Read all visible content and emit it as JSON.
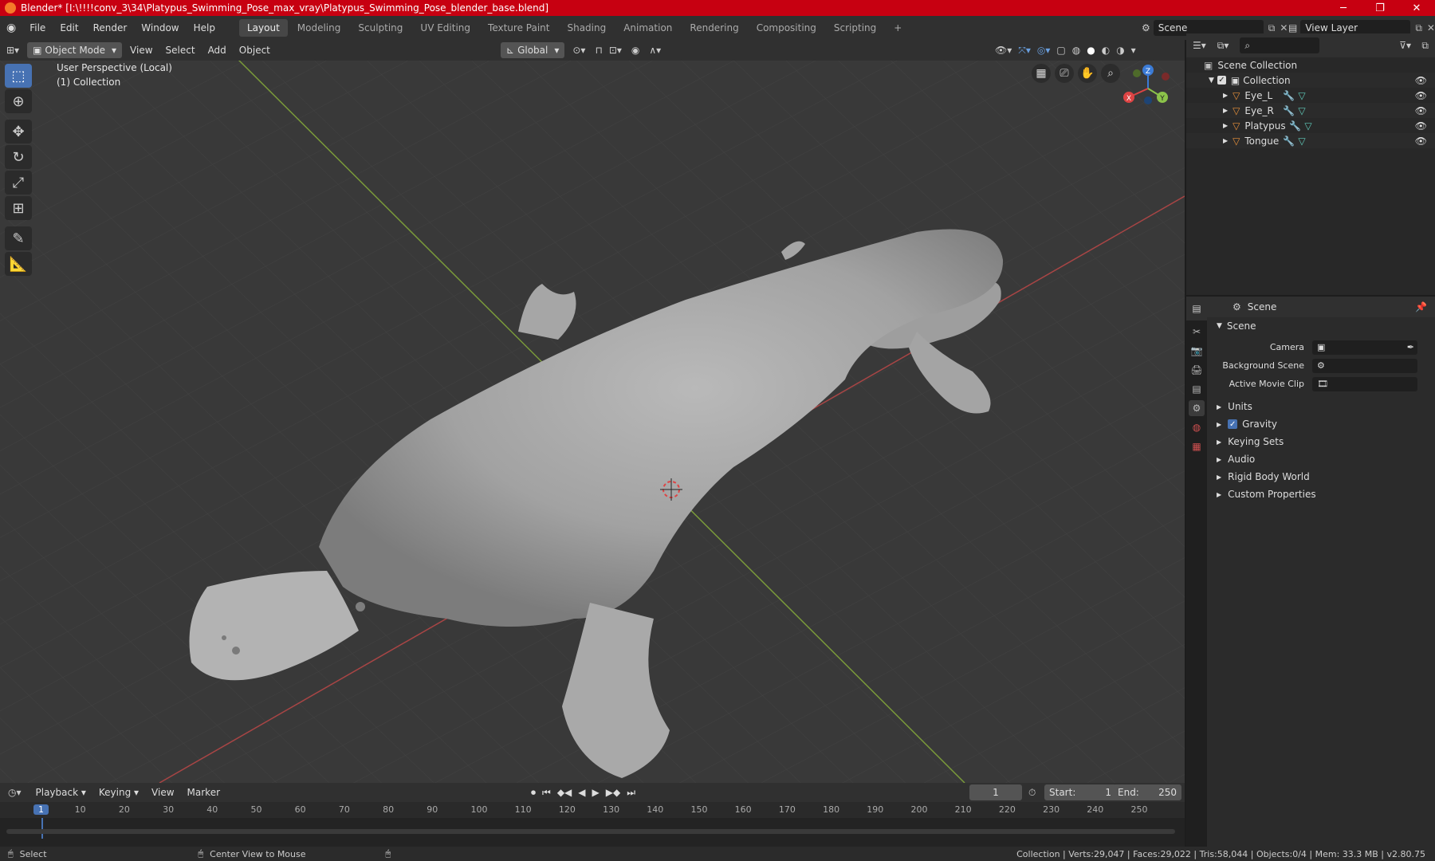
{
  "window": {
    "title": "Blender* [I:\\!!!!conv_3\\34\\Platypus_Swimming_Pose_max_vray\\Platypus_Swimming_Pose_blender_base.blend]"
  },
  "menus": [
    "File",
    "Edit",
    "Render",
    "Window",
    "Help"
  ],
  "workspaces": [
    "Layout",
    "Modeling",
    "Sculpting",
    "UV Editing",
    "Texture Paint",
    "Shading",
    "Animation",
    "Rendering",
    "Compositing",
    "Scripting"
  ],
  "active_workspace": "Layout",
  "scene_field": "Scene",
  "viewlayer_field": "View Layer",
  "viewport_header": {
    "mode": "Object Mode",
    "menus": [
      "View",
      "Select",
      "Add",
      "Object"
    ],
    "orientation": "Global"
  },
  "viewport": {
    "perspective": "User Perspective (Local)",
    "collection": "(1) Collection"
  },
  "gizmo": {
    "x": "X",
    "y": "Y",
    "z": "Z"
  },
  "outliner": {
    "root": "Scene Collection",
    "collection": "Collection",
    "items": [
      "Eye_L",
      "Eye_R",
      "Platypus",
      "Tongue"
    ]
  },
  "properties": {
    "header": "Scene",
    "panel": "Scene",
    "camera_label": "Camera",
    "bg_scene_label": "Background Scene",
    "movie_clip_label": "Active Movie Clip",
    "subpanels": [
      "Units",
      "Gravity",
      "Keying Sets",
      "Audio",
      "Rigid Body World",
      "Custom Properties"
    ]
  },
  "timeline": {
    "menus": [
      "Playback",
      "Keying",
      "View",
      "Marker"
    ],
    "current_frame": "1",
    "start_label": "Start:",
    "start": "1",
    "end_label": "End:",
    "end": "250",
    "ticks": [
      "1",
      "10",
      "20",
      "30",
      "40",
      "50",
      "60",
      "70",
      "80",
      "90",
      "100",
      "110",
      "120",
      "130",
      "140",
      "150",
      "160",
      "170",
      "180",
      "190",
      "200",
      "210",
      "220",
      "230",
      "240",
      "250"
    ]
  },
  "status": {
    "select": "Select",
    "center": "Center View to Mouse",
    "stats": "Collection | Verts:29,047 | Faces:29,022 | Tris:58,044 | Objects:0/4 | Mem: 33.3 MB | v2.80.75"
  },
  "colors": {
    "title_bar": "#c70011",
    "accent": "#4772b3",
    "object_icon": "#e8903a",
    "mesh_icon": "#5fc9b8"
  }
}
